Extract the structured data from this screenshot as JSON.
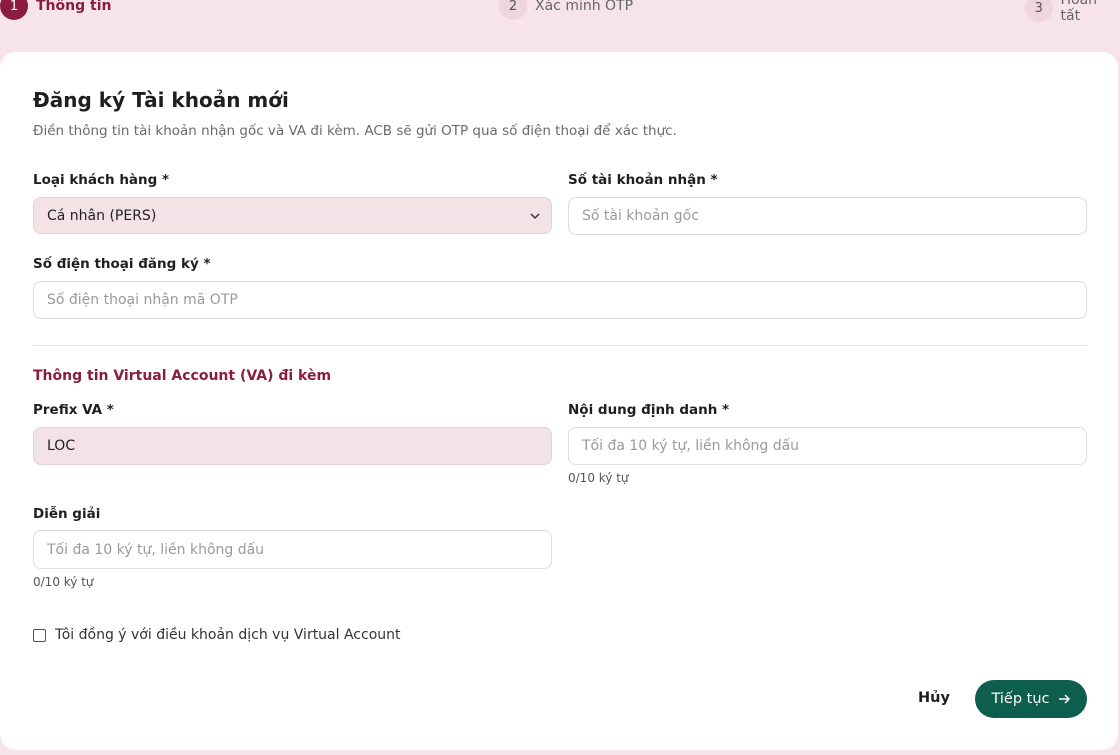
{
  "stepper": {
    "steps": [
      {
        "number": "1",
        "label": "Thông tin"
      },
      {
        "number": "2",
        "label": "Xác minh OTP"
      },
      {
        "number": "3",
        "label": "Hoàn tất"
      }
    ]
  },
  "form": {
    "title": "Đăng ký Tài khoản mới",
    "subtitle": "Điền thông tin tài khoản nhận gốc và VA đi kèm. ACB sẽ gửi OTP qua số điện thoại để xác thực.",
    "customer_type": {
      "label": "Loại khách hàng *",
      "value": "Cá nhân (PERS)"
    },
    "account_number": {
      "label": "Số tài khoản nhận *",
      "placeholder": "Số tài khoản gốc"
    },
    "phone": {
      "label": "Số điện thoại đăng ký *",
      "placeholder": "Số điện thoại nhận mã OTP"
    },
    "va_section_title": "Thông tin Virtual Account (VA) đi kèm",
    "prefix": {
      "label": "Prefix VA *",
      "value": "LOC"
    },
    "identifier": {
      "label": "Nội dung định danh *",
      "placeholder": "Tối đa 10 ký tự, liền không dấu",
      "counter": "0/10 ký tự"
    },
    "description": {
      "label": "Diễn giải",
      "placeholder": "Tối đa 10 ký tự, liền không dấu",
      "counter": "0/10 ký tự"
    },
    "terms_label": "Tôi đồng ý với điều khoản dịch vụ Virtual Account",
    "cancel_label": "Hủy",
    "next_label": "Tiếp tục"
  },
  "colors": {
    "accent": "#8b1c3d",
    "primary_button": "#0e5e4d",
    "filled_field": "#f3e3e7"
  }
}
